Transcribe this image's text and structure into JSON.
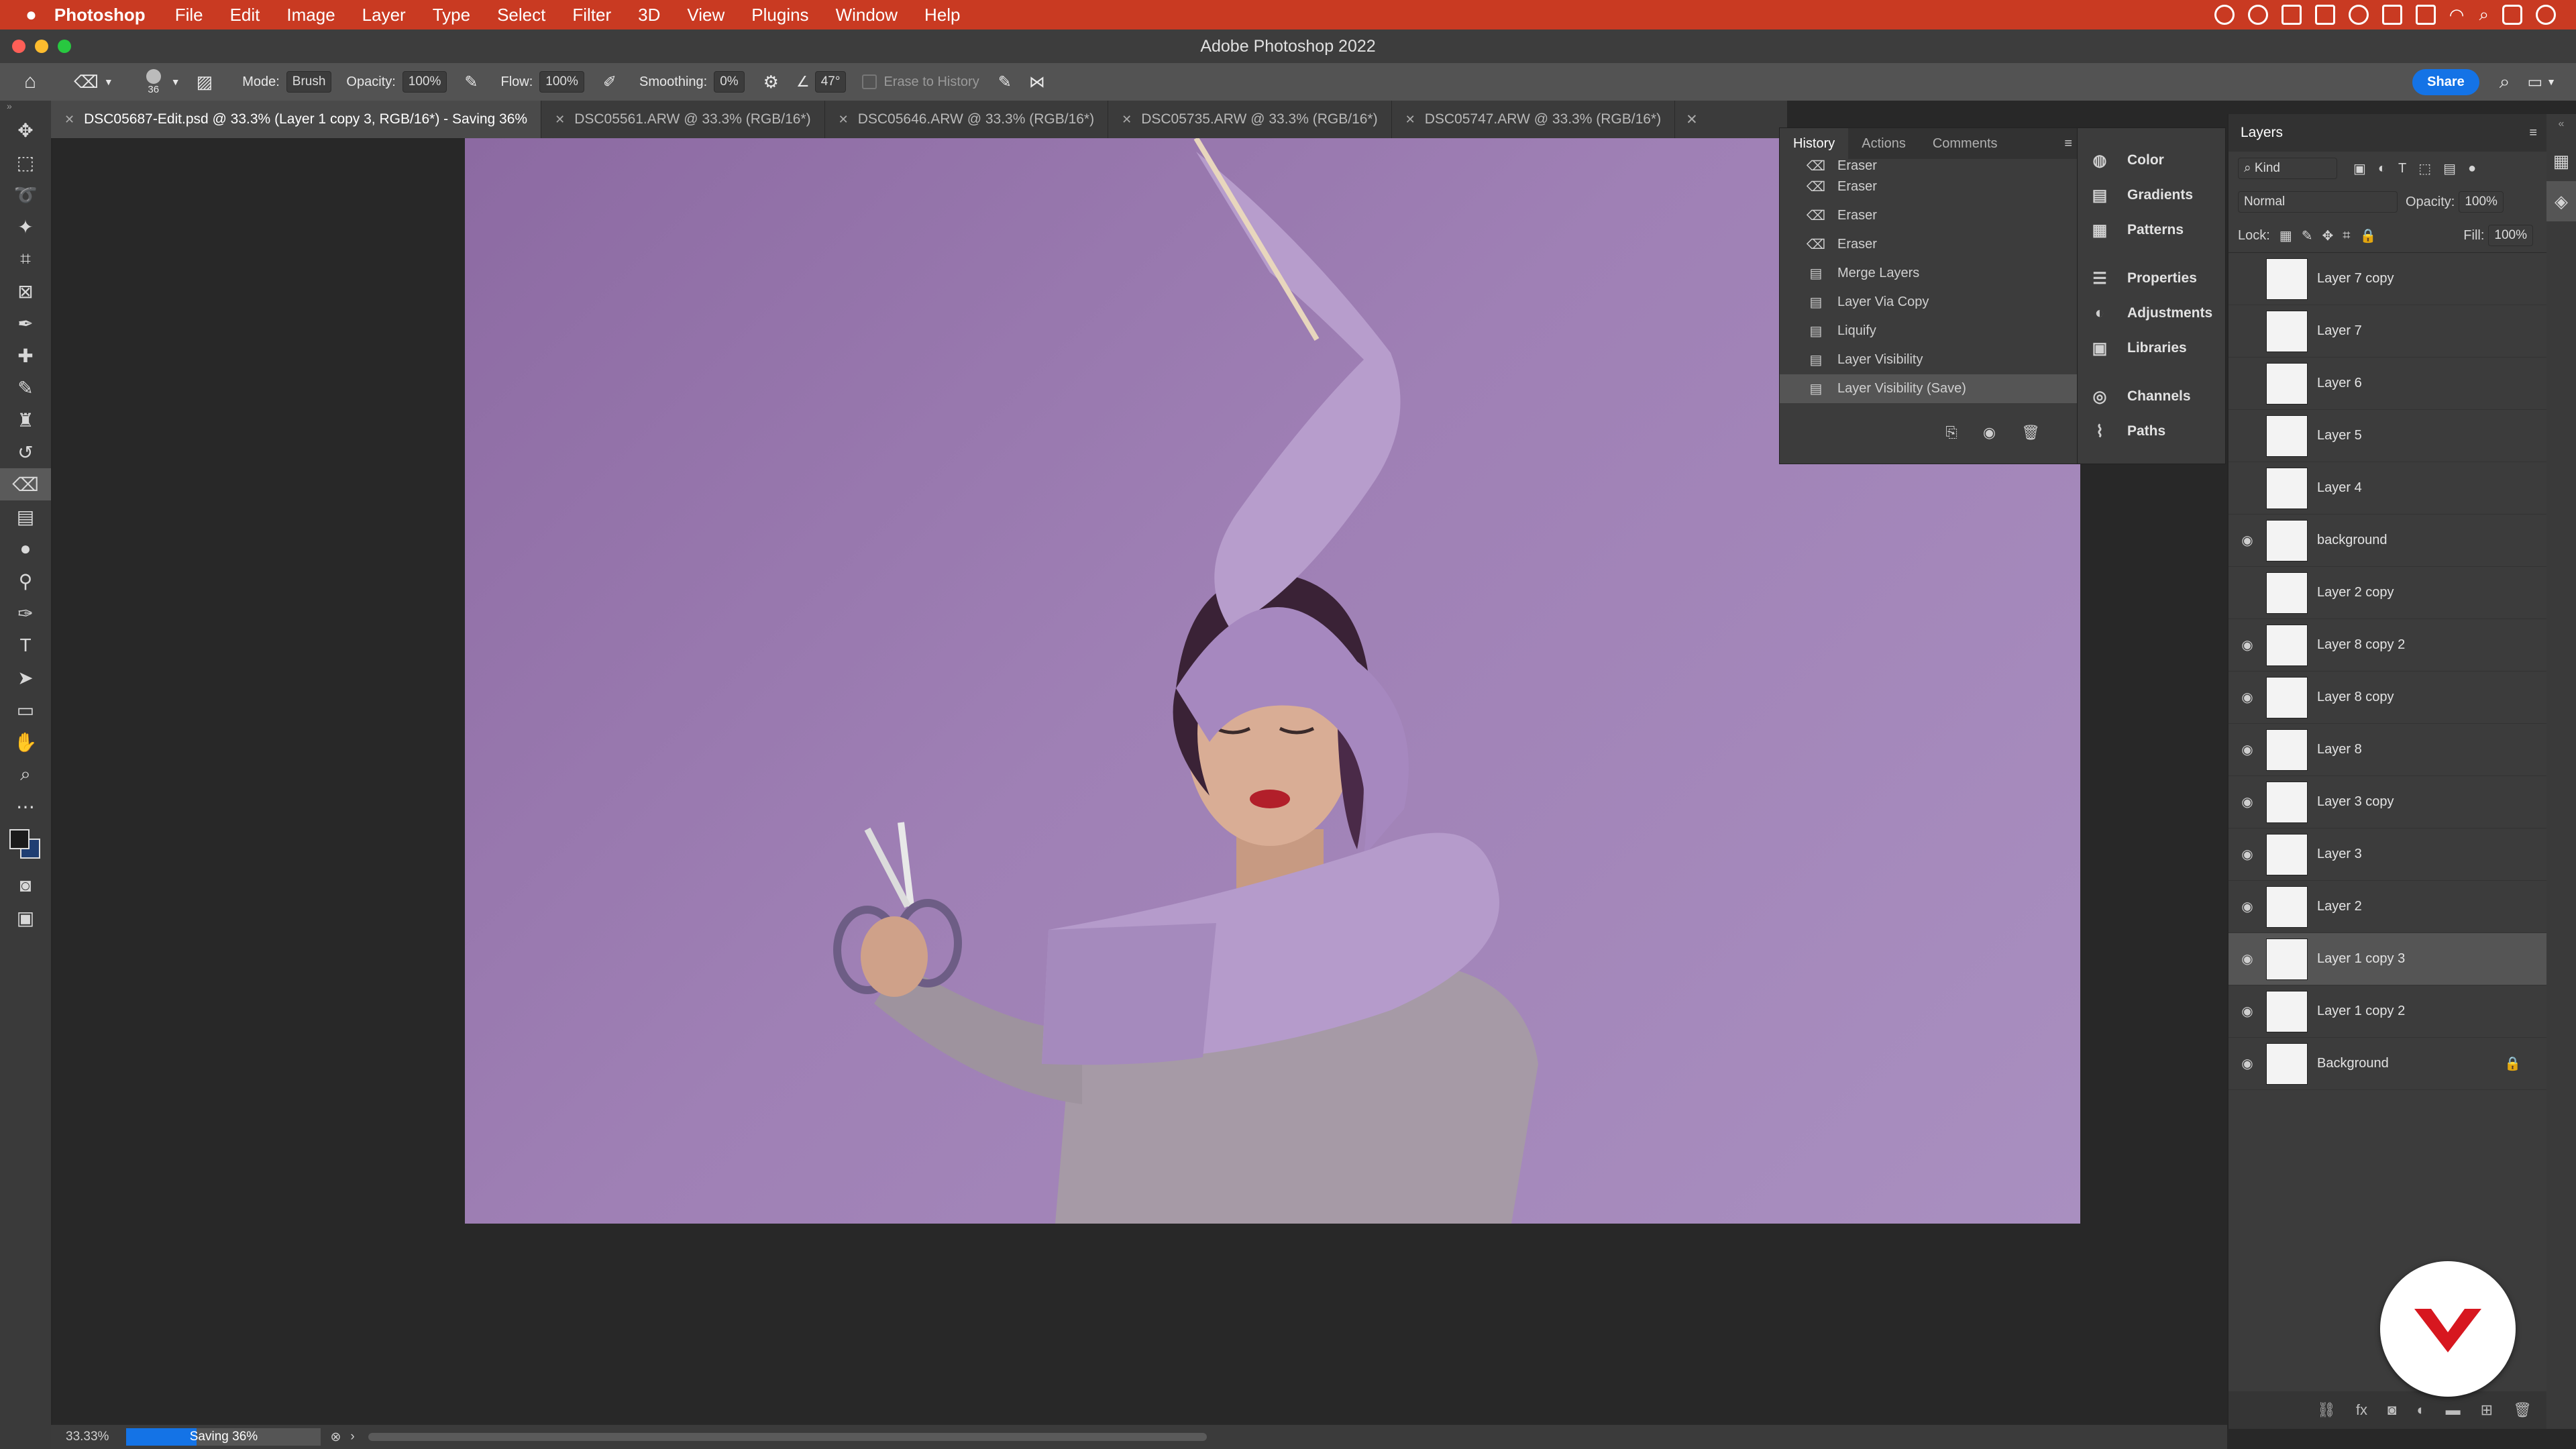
{
  "menubar": {
    "app": "Photoshop",
    "items": [
      "File",
      "Edit",
      "Image",
      "Layer",
      "Type",
      "Select",
      "Filter",
      "3D",
      "View",
      "Plugins",
      "Window",
      "Help"
    ]
  },
  "window": {
    "title": "Adobe Photoshop 2022"
  },
  "options": {
    "brush_size": "36",
    "mode_label": "Mode:",
    "mode_value": "Brush",
    "opacity_label": "Opacity:",
    "opacity_value": "100%",
    "flow_label": "Flow:",
    "flow_value": "100%",
    "smoothing_label": "Smoothing:",
    "smoothing_value": "0%",
    "angle_value": "47°",
    "erase_to_history": "Erase to History",
    "share_label": "Share"
  },
  "tabs": [
    {
      "label": "DSC05687-Edit.psd @ 33.3% (Layer 1 copy 3, RGB/16*) - Saving 36%"
    },
    {
      "label": "DSC05561.ARW @ 33.3% (RGB/16*)"
    },
    {
      "label": "DSC05646.ARW @ 33.3% (RGB/16*)"
    },
    {
      "label": "DSC05735.ARW @ 33.3% (RGB/16*)"
    },
    {
      "label": "DSC05747.ARW @ 33.3% (RGB/16*)"
    }
  ],
  "history": {
    "tabs": [
      "History",
      "Actions",
      "Comments"
    ],
    "items": [
      {
        "label": "Eraser",
        "icon": "eraser-icon"
      },
      {
        "label": "Eraser",
        "icon": "eraser-icon"
      },
      {
        "label": "Eraser",
        "icon": "eraser-icon"
      },
      {
        "label": "Eraser",
        "icon": "eraser-icon"
      },
      {
        "label": "Merge Layers",
        "icon": "document-icon"
      },
      {
        "label": "Layer Via Copy",
        "icon": "document-icon"
      },
      {
        "label": "Liquify",
        "icon": "document-icon"
      },
      {
        "label": "Layer Visibility",
        "icon": "document-icon"
      },
      {
        "label": "Layer Visibility (Save)",
        "icon": "document-icon"
      }
    ]
  },
  "mini_panels": {
    "items": [
      "Color",
      "Gradients",
      "Patterns",
      "Properties",
      "Adjustments",
      "Libraries",
      "Channels",
      "Paths"
    ]
  },
  "layers": {
    "title": "Layers",
    "kind": "Kind",
    "blend": "Normal",
    "opacity_label": "Opacity:",
    "opacity_value": "100%",
    "lock_label": "Lock:",
    "fill_label": "Fill:",
    "fill_value": "100%",
    "rows": [
      {
        "name": "Layer 7 copy",
        "visible": false
      },
      {
        "name": "Layer 7",
        "visible": false
      },
      {
        "name": "Layer 6",
        "visible": false
      },
      {
        "name": "Layer 5",
        "visible": false
      },
      {
        "name": "Layer 4",
        "visible": false
      },
      {
        "name": "background",
        "visible": true
      },
      {
        "name": "Layer 2 copy",
        "visible": false
      },
      {
        "name": "Layer 8 copy 2",
        "visible": true
      },
      {
        "name": "Layer 8 copy",
        "visible": true
      },
      {
        "name": "Layer 8",
        "visible": true
      },
      {
        "name": "Layer 3 copy",
        "visible": true
      },
      {
        "name": "Layer 3",
        "visible": true
      },
      {
        "name": "Layer 2",
        "visible": true
      },
      {
        "name": "Layer 1 copy 3",
        "visible": true,
        "selected": true
      },
      {
        "name": "Layer 1 copy 2",
        "visible": true
      },
      {
        "name": "Background",
        "visible": true,
        "locked": true
      }
    ]
  },
  "status": {
    "zoom": "33.33%",
    "saving": "Saving 36%",
    "saving_progress": 0.36
  },
  "colors": {
    "menubar": "#c93a22",
    "accent": "#1473e6",
    "canvas": "#9f80b5"
  }
}
